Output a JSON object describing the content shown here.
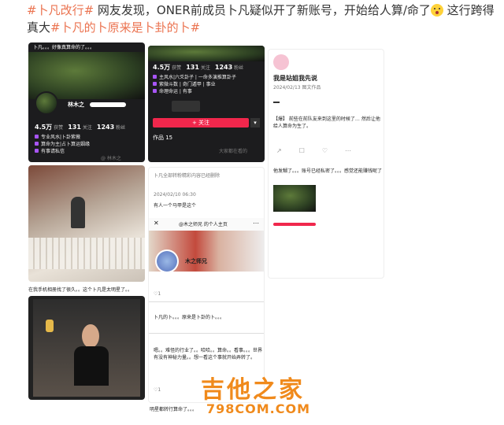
{
  "headline": {
    "tag1": "#卜凡改行#",
    "text1": " 网友发现，ONER前成员卜凡疑似开了新账号，开始给人算/命了",
    "text2": " 这行跨得真大",
    "tag2": "#卜凡的卜原来是卜卦的卜#"
  },
  "p1": {
    "top_text": "卜凡。。。好像真算命的了。。。",
    "name": "林木之",
    "stats": [
      {
        "n": "4.5万",
        "l": "获赞"
      },
      {
        "n": "131",
        "l": "关注"
      },
      {
        "n": "1243",
        "l": "粉丝"
      }
    ],
    "lines": [
      "专业风水|卜卦紫薇",
      "算命为主|占卜算运姻缘",
      "有事请私信"
    ],
    "footer": "@ 林木之"
  },
  "p2": {
    "stats": [
      {
        "n": "4.5万",
        "l": "获赞"
      },
      {
        "n": "131",
        "l": "关注"
      },
      {
        "n": "1243",
        "l": "粉丝"
      }
    ],
    "lines": [
      "主风水|六爻卦子 | 一命多演推算卦子",
      "紫微斗数 | 奇门遁甲 | 事业",
      "命理命运 | 有事"
    ],
    "btn_follow": "+ 关注",
    "tab": "作品 15",
    "footer": "大家都在看的"
  },
  "p3": {
    "name": "我是站姐我先说",
    "sub": "2024/02/13 图文作品",
    "body": "【爆】 前些在前队友来到这里的时候了… 然后让他给人算命为生了。",
    "comment": "他发糊了。。。",
    "comment2": "账号已经私密了。。。感觉还能赚钱呢了"
  },
  "p4": {
    "caption": "在我手机相册找了很久。。这个卜凡是太明星了。。"
  },
  "p5": {
    "meta": "卜凡全部转粉精彩内容已经删除",
    "date": "2024/02/10 06:30",
    "q": "有人一个马甲是这个",
    "profile_title": "@木之师兄 的个人主页",
    "profile_name": "木之师兄",
    "likes": "1",
    "c1": "卜凡的卜。。。原来是卜卦的卜。。。",
    "c2": "嗯。。难怪的行业了。。哈哈。。算命。。看事。。。世界有没有神秘力量。。想一看这个事就开始弄转了。",
    "c3": "明星都转行算命了。。。",
    "likes2": "1"
  },
  "watermark": {
    "cn": "吉他之家",
    "en": "798COM.COM"
  }
}
